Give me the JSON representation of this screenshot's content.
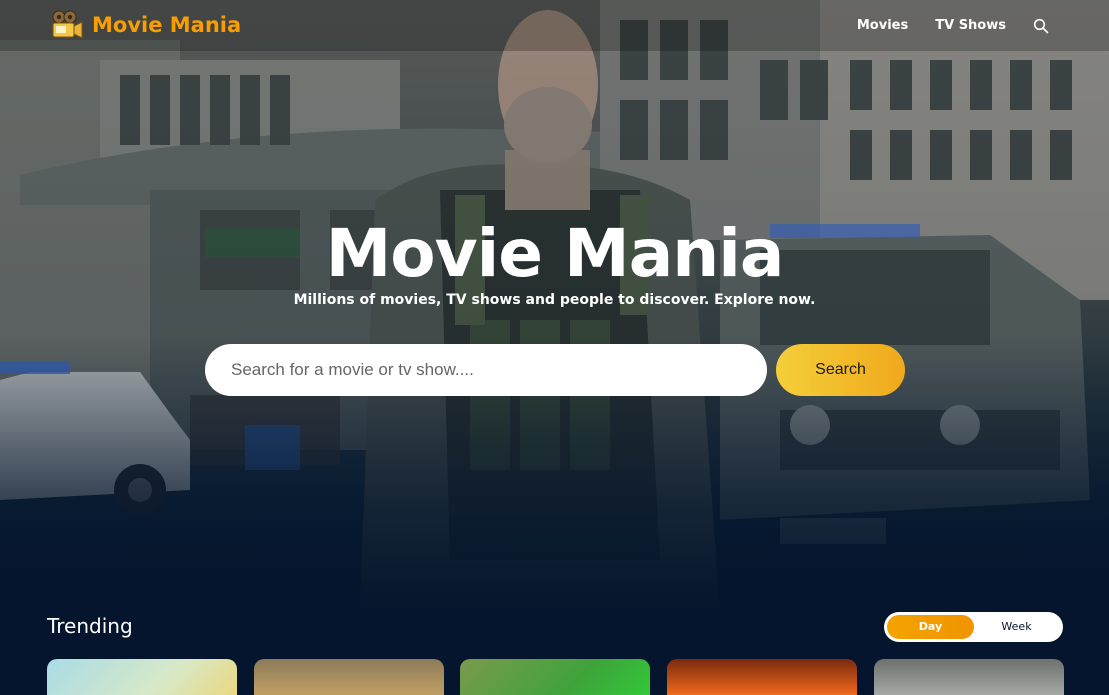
{
  "header": {
    "logo_text": "Movie Mania",
    "logo_icon": "film-camera-icon",
    "nav": [
      {
        "label": "Movies"
      },
      {
        "label": "TV Shows"
      }
    ],
    "search_icon": "search-icon"
  },
  "hero": {
    "title": "Movie Mania",
    "subtitle": "Millions of movies, TV shows and people to discover. Explore now.",
    "search_placeholder": "Search for a movie or tv show....",
    "search_button": "Search"
  },
  "trending": {
    "title": "Trending",
    "tabs": [
      {
        "label": "Day",
        "active": true
      },
      {
        "label": "Week",
        "active": false
      }
    ]
  },
  "colors": {
    "brand": "#f89e00",
    "background": "#04152d",
    "search_button_gradient": [
      "#f4cf3a",
      "#f0a91c"
    ]
  }
}
